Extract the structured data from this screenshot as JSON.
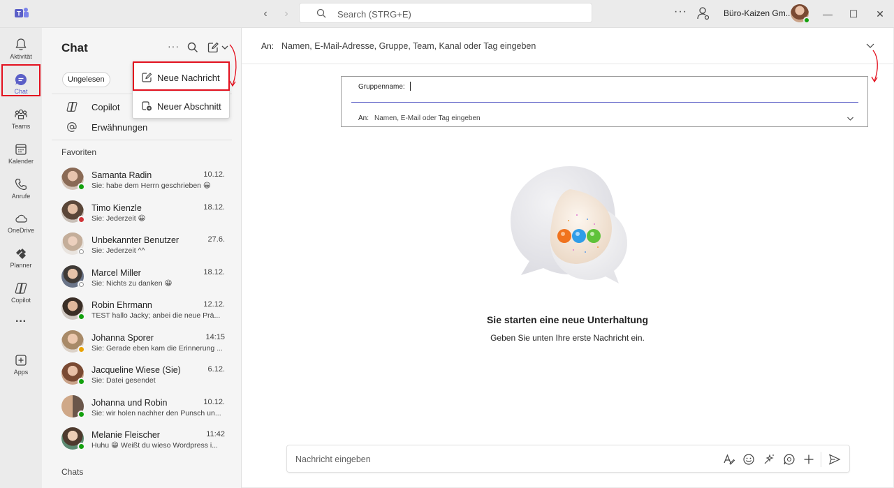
{
  "titlebar": {
    "search_placeholder": "Search (STRG+E)",
    "org_name": "Büro-Kaizen Gm...",
    "more": "···"
  },
  "rail": {
    "items": [
      {
        "label": "Aktivität"
      },
      {
        "label": "Chat"
      },
      {
        "label": "Teams"
      },
      {
        "label": "Kalender"
      },
      {
        "label": "Anrufe"
      },
      {
        "label": "OneDrive"
      },
      {
        "label": "Planner"
      },
      {
        "label": "Copilot"
      },
      {
        "label": "···"
      },
      {
        "label": "Apps"
      }
    ]
  },
  "chatlist": {
    "title": "Chat",
    "more": "···",
    "filter_chip": "Ungelesen",
    "quick": [
      {
        "label": "Copilot"
      },
      {
        "label": "Erwähnungen"
      }
    ],
    "favorites_header": "Favoriten",
    "chats_header": "Chats",
    "rows": [
      {
        "name": "Samanta Radin",
        "preview": "Sie: habe dem Herrn geschrieben 😀",
        "time": "10.12.",
        "status_color": "#13a10e",
        "avatar_color": "#8a6a55"
      },
      {
        "name": "Timo Kienzle",
        "preview": "Sie: Jederzeit 😀",
        "time": "18.12.",
        "status_color": "#d13438",
        "avatar_color": "#6b5a4a"
      },
      {
        "name": "Unbekannter Benutzer",
        "preview": "Sie: Jederzeit ^^",
        "time": "27.6.",
        "status_color": "#ffffff",
        "avatar_color": "#b9a89a"
      },
      {
        "name": "Marcel Miller",
        "preview": "Sie: Nichts zu danken 😀",
        "time": "18.12.",
        "status_color": "#ffffff",
        "avatar_color": "#5a6272"
      },
      {
        "name": "Robin Ehrmann",
        "preview": "TEST   hallo Jacky;   anbei die neue Prä...",
        "time": "12.12.",
        "status_color": "#13a10e",
        "avatar_color": "#4d4038"
      },
      {
        "name": "Johanna Sporer",
        "preview": "Sie: Gerade eben kam die Erinnerung ...",
        "time": "14:15",
        "status_color": "#eaa300",
        "avatar_color": "#8f7a62"
      },
      {
        "name": "Jacqueline Wiese (Sie)",
        "preview": "Sie: Datei gesendet",
        "time": "6.12.",
        "status_color": "#13a10e",
        "avatar_color": "#7e5a48"
      },
      {
        "name": "Johanna und Robin",
        "preview": "Sie: wir holen nachher den Punsch un...",
        "time": "10.12.",
        "status_color": "#13a10e",
        "avatar_color": "#6f6258"
      },
      {
        "name": "Melanie Fleischer",
        "preview": "Huhu 😀 Weißt du wieso Wordpress i...",
        "time": "11:42",
        "status_color": "#13a10e",
        "avatar_color": "#5d7a6a"
      }
    ]
  },
  "dropdown": {
    "items": [
      {
        "label": "Neue Nachricht"
      },
      {
        "label": "Neuer Abschnitt"
      }
    ]
  },
  "main": {
    "to_label": "An:",
    "to_placeholder": "Namen, E-Mail-Adresse, Gruppe, Team, Kanal oder Tag eingeben",
    "group_label": "Gruppenname:",
    "group_to_label": "An:",
    "group_to_placeholder": "Namen, E-Mail oder Tag eingeben",
    "empty_title": "Sie starten eine neue Unterhaltung",
    "empty_subtitle": "Geben Sie unten Ihre erste Nachricht ein.",
    "compose_placeholder": "Nachricht eingeben"
  },
  "colors": {
    "accent": "#5b5fc7",
    "highlight_red": "#e3101e"
  }
}
